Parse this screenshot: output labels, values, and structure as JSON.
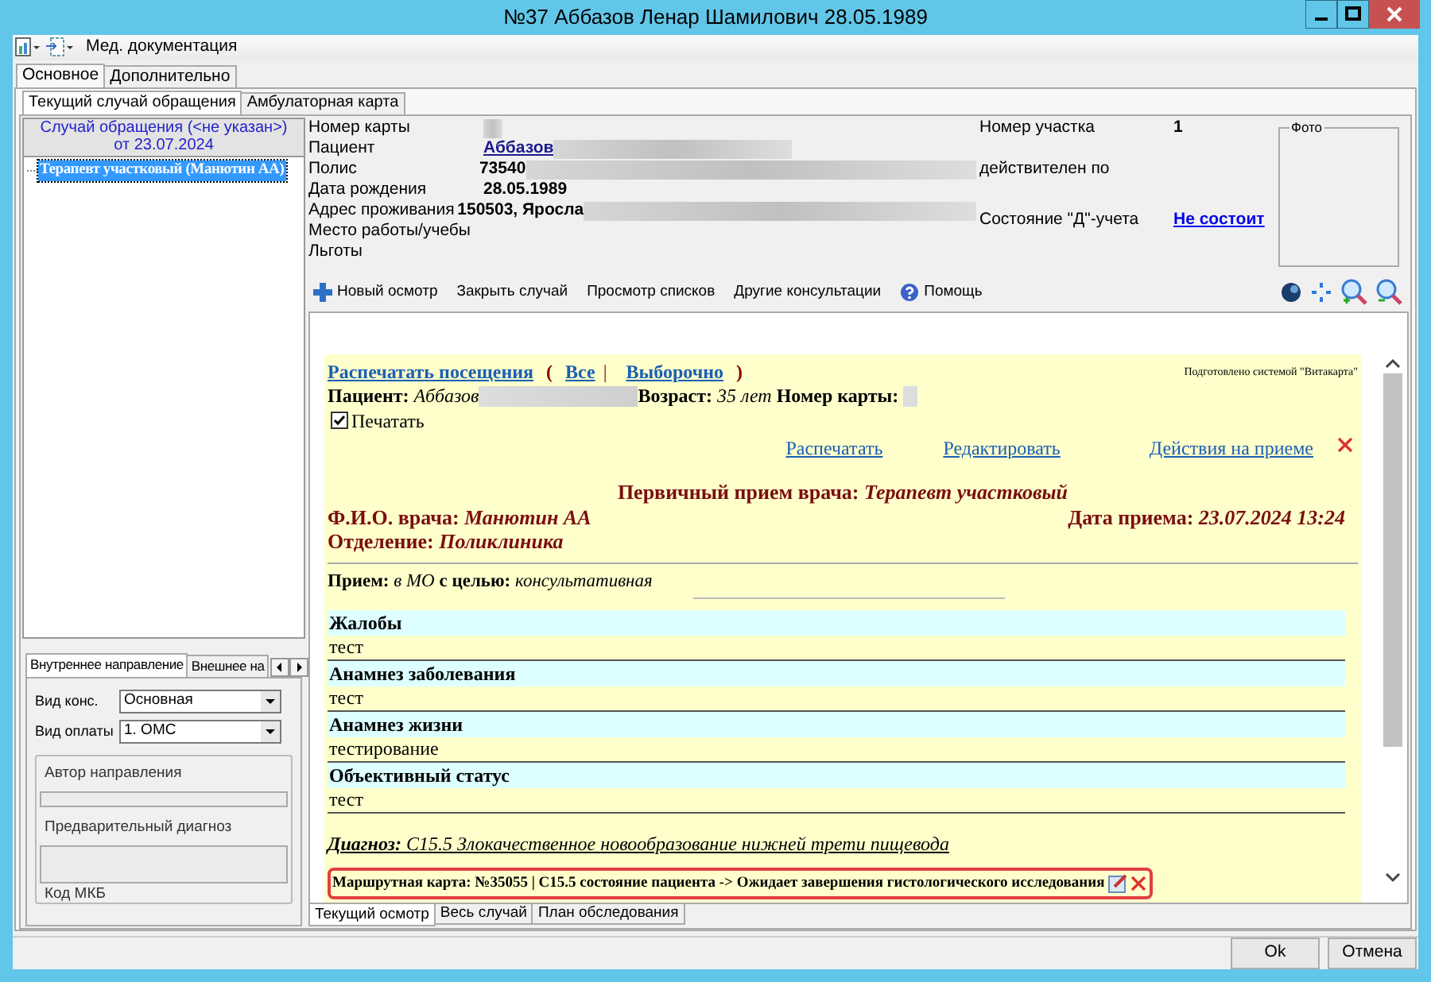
{
  "window": {
    "title": "№37 Аббазов Ленар Шамилович 28.05.1989"
  },
  "toolbar": {
    "menu_label": "Мед. документация"
  },
  "main_tabs": [
    {
      "label": "Основное",
      "selected": true
    },
    {
      "label": "Дополнительно",
      "selected": false
    }
  ],
  "sub_tabs": [
    {
      "label": "Текущий случай обращения",
      "selected": true
    },
    {
      "label": "Амбулаторная карта",
      "selected": false
    }
  ],
  "case_panel": {
    "header": [
      "Случай обращения (<не указан>)",
      "от 23.07.2024"
    ],
    "tree": [
      {
        "label": "Терапевт участковый (Манютин АА)",
        "selected": true
      }
    ]
  },
  "referral_tabs": [
    {
      "label": "Внутреннее направление",
      "selected": true
    },
    {
      "label": "Внешнее на",
      "selected": false
    }
  ],
  "referral_form": {
    "fields": [
      {
        "label": "Вид конс.",
        "value": "Основная"
      },
      {
        "label": "Вид оплаты",
        "value": "1. ОМС"
      }
    ],
    "author_label": "Автор направления",
    "diagnosis_label": "Предварительный диагноз",
    "mkb_label": "Код МКБ"
  },
  "patient_info": {
    "rows": [
      {
        "label": "Номер карты",
        "redacted": true
      },
      {
        "label": "Пациент",
        "value": "Аббазов",
        "kind": "link",
        "redacted": true
      },
      {
        "label": "Полис",
        "value": "73540",
        "kind": "text",
        "redacted": true
      },
      {
        "label": "Дата рождения",
        "value": "28.05.1989",
        "kind": "text",
        "redacted": false
      },
      {
        "label": "Адрес проживания",
        "value": "150503, Яросла",
        "kind": "text",
        "redacted": true
      },
      {
        "label": "Место работы/учебы",
        "redacted": false
      },
      {
        "label": "Льготы",
        "redacted": false
      }
    ],
    "extra_rows": [
      {
        "label": "Номер участка",
        "value": "1",
        "kind": "text"
      },
      {
        "label": "действителен по"
      },
      {
        "label": "Состояние \"Д\"-учета",
        "value": "Не состоит",
        "kind": "link"
      }
    ],
    "photo_label": "Фото"
  },
  "actions": [
    {
      "label": "Новый осмотр",
      "kind": "add"
    },
    {
      "label": "Закрыть случай",
      "kind": "plain"
    },
    {
      "label": "Просмотр списков",
      "kind": "plain"
    },
    {
      "label": "Другие консультации",
      "kind": "plain"
    },
    {
      "label": "Помощь",
      "kind": "help"
    }
  ],
  "document": {
    "print_line": {
      "main": "Распечатать посещения",
      "open": "(",
      "all": "Все",
      "sep": "|",
      "selective": "Выборочно",
      "close": ")"
    },
    "credit": "Подготовлено системой \"Витакарта\"",
    "patient_line": [
      "**Пациент:** *Аббазов*",
      "**Возраст:** *35 лет* **Номер карты:**"
    ],
    "print_checkbox": {
      "label": "Печатать",
      "checked": true
    },
    "visit_actions": [
      "Распечатать",
      "Редактировать",
      "Действия на приеме"
    ],
    "visit_title": "Первичный прием врача: *Терапевт участковый*",
    "doctor": "Ф.И.О. врача: *Манютин АА*",
    "visit_date": "Дата приема: *23.07.2024 13:24*",
    "department": "Отделение: *Поликлиника*",
    "purpose": "**Прием:** *в МО* **с целью:** *консультативная*",
    "sections": [
      {
        "title": "Жалобы",
        "text": "тест"
      },
      {
        "title": "Анамнез заболевания",
        "text": "тест"
      },
      {
        "title": "Анамнез жизни",
        "text": "тестирование"
      },
      {
        "title": "Объективный статус",
        "text": "тест"
      }
    ],
    "diagnosis": "**Диагноз:** C15.5 Злокачественное новообразование нижней трети пищевода",
    "route_card": "Маршрутная карта: №35055 | C15.5 состояние пациента -> Ожидает завершения гистологического исследования"
  },
  "bottom_tabs": [
    {
      "label": "Текущий осмотр",
      "selected": true
    },
    {
      "label": "Весь случай",
      "selected": false
    },
    {
      "label": "План обследования",
      "selected": false
    }
  ],
  "buttons": [
    "Ok",
    "Отмена"
  ]
}
